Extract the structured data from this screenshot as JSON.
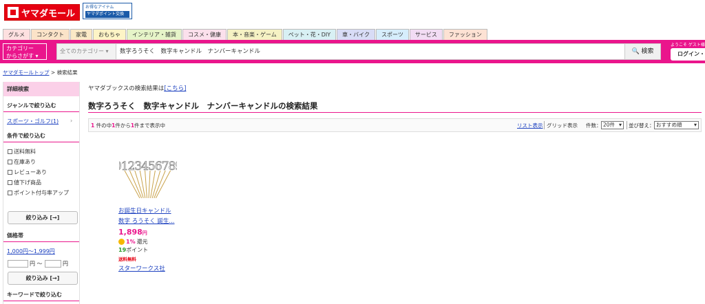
{
  "header": {
    "logo_text": "ヤマダモール",
    "badge_line1": "お得なアイテム",
    "badge_line2": "ヤマダポイント交換"
  },
  "tabs": [
    {
      "label": "グルメ",
      "color": "#fde0e0"
    },
    {
      "label": "コンタクト",
      "color": "#fbe3c8"
    },
    {
      "label": "家電",
      "color": "#fbe9c6"
    },
    {
      "label": "おもちゃ",
      "color": "#fdf4c6"
    },
    {
      "label": "インテリア・雑貨",
      "color": "#e6f4c8"
    },
    {
      "label": "コスメ・健康",
      "color": "#fbe0ec"
    },
    {
      "label": "本・音楽・ゲーム",
      "color": "#f6f2c4"
    },
    {
      "label": "ペット・花・DIY",
      "color": "#d8f0f4"
    },
    {
      "label": "車・バイク",
      "color": "#d8dcf6"
    },
    {
      "label": "スポーツ",
      "color": "#d6eefc"
    },
    {
      "label": "サービス",
      "color": "#f2dcf4"
    },
    {
      "label": "ファッション",
      "color": "#fde2d4"
    }
  ],
  "search": {
    "category_button": "カテゴリー\nからさがす ▾",
    "category_select": "全てのカテゴリー",
    "query": "数字ろうそく　数字キャンドル　ナンバーキャンドル",
    "button": "検索",
    "welcome": "ようこそ ゲスト様",
    "login": "ログイン・会員登録"
  },
  "breadcrumb": {
    "home": "ヤマダモールトップ",
    "sep": ">",
    "current": "検索結果"
  },
  "sidebar": {
    "title": "詳細検索",
    "genre_heading": "ジャンルで絞り込む",
    "genre_link": "スポーツ・ゴルフ(1)",
    "cond_heading": "条件で絞り込む",
    "conditions": [
      "送料無料",
      "在庫あり",
      "レビューあり",
      "値下げ商品",
      "ポイント付与率アップ"
    ],
    "refine_button": "絞り込み [→]",
    "price_heading": "価格帯",
    "price_link": "1,000円〜1,999円",
    "price_from_unit": "円 〜",
    "price_to_unit": "円",
    "refine_button2": "絞り込み [→]",
    "keyword_heading": "キーワードで絞り込む"
  },
  "main": {
    "notice_text": "ヤマダブックスの検索結果は",
    "notice_link": "[こちら]",
    "title": "数字ろうそく　数字キャンドル　ナンバーキャンドルの検索結果",
    "count_n1": "1",
    "count_mid1": " 件の中",
    "count_n2": "1",
    "count_mid2": "件から",
    "count_n3": "1",
    "count_end": "件まで表示中",
    "list_view": "リスト表示",
    "grid_view": "グリッド表示",
    "count_label": "件数：",
    "count_select": "20件",
    "sort_label": "並び替え：",
    "sort_select": "おすすめ順"
  },
  "product": {
    "image_digits": "0123456789",
    "name_line1": "お誕生日キャンドル",
    "name_line2": "数字 ろうそく 誕生...",
    "price": "1,898",
    "price_unit": "円",
    "cashback_rate": "1%",
    "cashback_label": "還元",
    "points_value": "19",
    "points_label": "ポイント",
    "shipping": "送料無料",
    "shop": "スターワークス社"
  },
  "colors": {
    "brand_red": "#e60012",
    "accent_pink": "#ea158c"
  }
}
